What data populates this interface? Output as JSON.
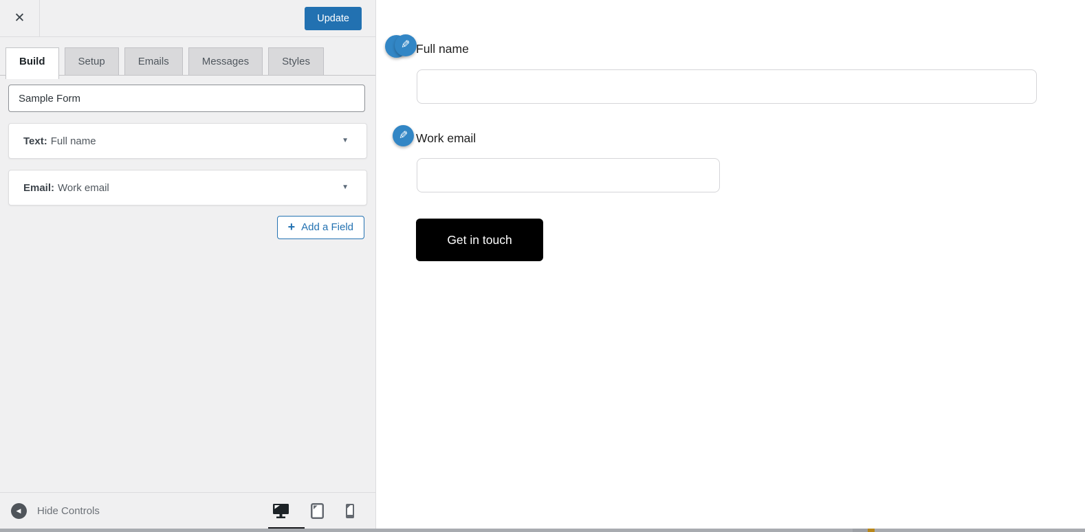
{
  "colors": {
    "accent_blue": "#2271b1",
    "edit_icon_blue": "#3286c5",
    "submit_button_black": "#000000",
    "panel_background": "#f0f0f1",
    "active_device_indicator": "#17191c"
  },
  "icons": {
    "close": "✕",
    "plus": "+",
    "caret": "▼",
    "back": "◀",
    "pencil": "✎"
  },
  "editor": {
    "update_button": "Update",
    "tabs": [
      {
        "label": "Build",
        "active": true
      },
      {
        "label": "Setup",
        "active": false
      },
      {
        "label": "Emails",
        "active": false
      },
      {
        "label": "Messages",
        "active": false
      },
      {
        "label": "Styles",
        "active": false
      }
    ],
    "form_title": "Sample Form",
    "fields": [
      {
        "type": "Text:",
        "name": "Full name"
      },
      {
        "type": "Email:",
        "name": "Work email"
      }
    ],
    "add_field_label": "Add a Field",
    "footer": {
      "hide_controls": "Hide Controls",
      "devices": [
        {
          "name": "desktop",
          "active": true
        },
        {
          "name": "tablet",
          "active": false
        },
        {
          "name": "mobile",
          "active": false
        }
      ]
    }
  },
  "preview": {
    "fields": [
      {
        "label": "Full name",
        "value": ""
      },
      {
        "label": "Work email",
        "value": ""
      }
    ],
    "submit_label": "Get in touch"
  }
}
